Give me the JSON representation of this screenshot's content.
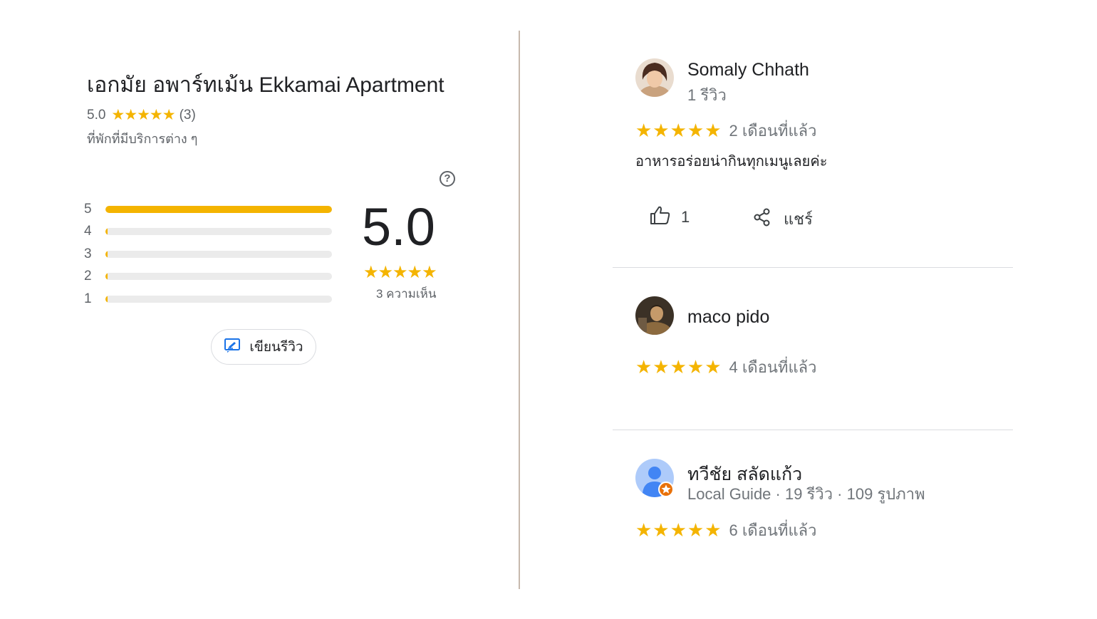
{
  "place": {
    "title": "เอกมัย อพาร์ทเม้น Ekkamai Apartment",
    "rating": "5.0",
    "stars": "★★★★★",
    "count": "(3)",
    "category": "ที่พักที่มีบริการต่าง ๆ",
    "help_glyph": "?"
  },
  "histogram": [
    {
      "label": "5",
      "fraction": 1.0
    },
    {
      "label": "4",
      "fraction": 0.0
    },
    {
      "label": "3",
      "fraction": 0.0
    },
    {
      "label": "2",
      "fraction": 0.0
    },
    {
      "label": "1",
      "fraction": 0.0
    }
  ],
  "summary": {
    "score": "5.0",
    "stars": "★★★★★",
    "reviews_label": "3 ความเห็น"
  },
  "write_review": {
    "label": "เขียนรีวิว",
    "icon": "edit-review-icon"
  },
  "reviews": [
    {
      "name": "Somaly Chhath",
      "meta": "1 รีวิว",
      "stars": "★★★★★",
      "time": "2 เดือนที่แล้ว",
      "text": "อาหารอร่อยน่ากินทุกเมนูเลยค่ะ",
      "likes": "1",
      "share_label": "แชร์"
    },
    {
      "name": "maco pido",
      "meta": "",
      "stars": "★★★★★",
      "time": "4 เดือนที่แล้ว"
    },
    {
      "name": "ทวีชัย สลัดแก้ว",
      "meta": "Local Guide · 19 รีวิว · 109 รูปภาพ",
      "stars": "★★★★★",
      "time": "6 เดือนที่แล้ว"
    }
  ],
  "colors": {
    "star": "#f4b400",
    "accent_blue": "#1a73e8",
    "muted_text": "#70757a"
  }
}
